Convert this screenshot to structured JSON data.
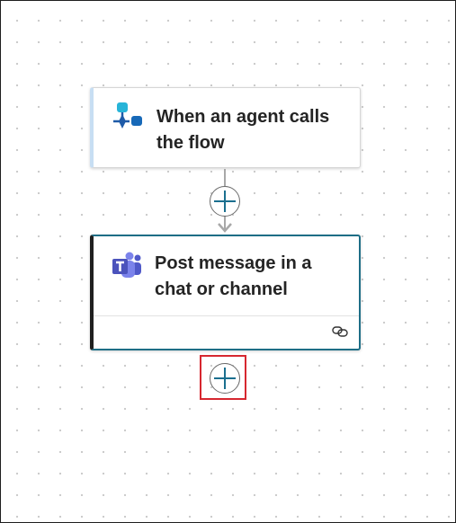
{
  "flow": {
    "trigger": {
      "title": "When an agent calls the flow",
      "icon": "agent-trigger-icon",
      "accent": "#c7def3"
    },
    "action": {
      "title": "Post message in a chat or channel",
      "icon": "teams-icon",
      "accent": "#1e6e86"
    },
    "insert_step_icon": "plus-icon",
    "new_step_icon": "plus-icon",
    "highlight_color": "#d6272f"
  }
}
